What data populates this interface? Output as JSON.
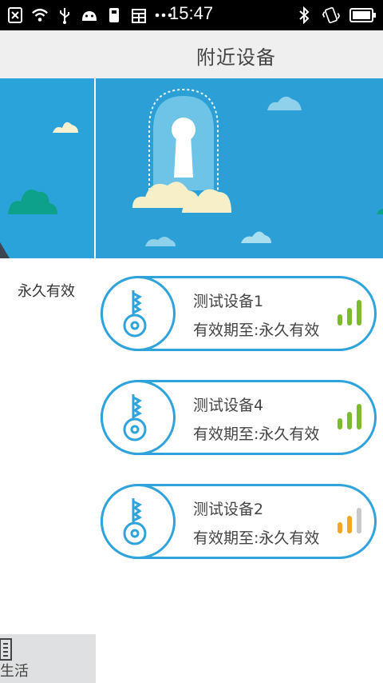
{
  "status_bar": {
    "time": "15:47",
    "left_icons": [
      "close-box-icon",
      "wifi-icon",
      "usb-icon",
      "android-icon",
      "sim-icon",
      "calendar-icon",
      "more-dots-icon"
    ],
    "right_icons": [
      "bluetooth-icon",
      "vibrate-icon",
      "battery-icon"
    ]
  },
  "header": {
    "title": "附近设备"
  },
  "sidebar": {
    "label": "永久有效"
  },
  "bottom_nav": {
    "label": "生活",
    "icon": "building-icon"
  },
  "devices": [
    {
      "name": "测试设备1",
      "validity": "有效期至:永久有效",
      "signal": 3,
      "signal_color": "#7cba2e"
    },
    {
      "name": "测试设备4",
      "validity": "有效期至:永久有效",
      "signal": 3,
      "signal_color": "#7cba2e"
    },
    {
      "name": "测试设备2",
      "validity": "有效期至:永久有效",
      "signal": 2,
      "signal_color": "#f5a623"
    }
  ],
  "colors": {
    "accent": "#2fa3dc",
    "banner": "#2b9fd6",
    "title_bar": "#efeff0"
  }
}
